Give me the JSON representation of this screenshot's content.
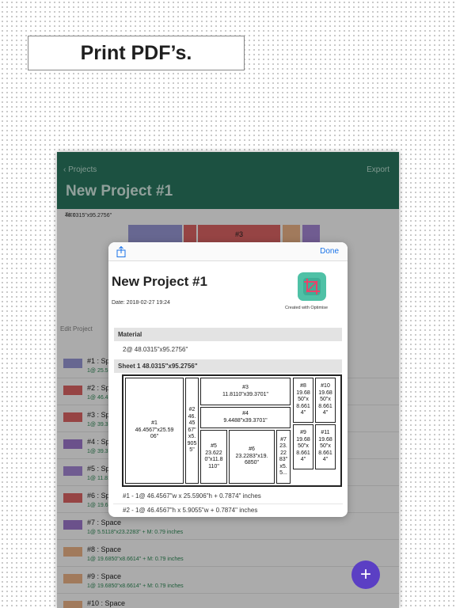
{
  "banner": {
    "text": "Print PDF’s."
  },
  "app": {
    "back_label": "Projects",
    "export_label": "Export",
    "title": "New Project #1",
    "size_caption": "Size",
    "size_value": "48.0315\"x95.2756\"",
    "preview_label": "#3",
    "edit_label": "Edit Project",
    "list": [
      {
        "name": "#1 : Space",
        "detail": "1@ 25.5906\"x46.4567\" + M: 0.79 inches",
        "color": "#9a9ad9"
      },
      {
        "name": "#2 : Space",
        "detail": "1@ 46.4567\"x5.9055\" + M: 0.79 inches",
        "color": "#e06666"
      },
      {
        "name": "#3 : Space",
        "detail": "1@ 39.3701\"x11.8110\" + M: 0.79 inches",
        "color": "#e06666"
      },
      {
        "name": "#4 : Space",
        "detail": "1@ 39.3701\"x9.4488\" + M: 0.79 inches",
        "color": "#a07ad0"
      },
      {
        "name": "#5 : Space",
        "detail": "1@ 11.8110\"x23.6220\" + M: 0.79 inches",
        "color": "#a88ad8"
      },
      {
        "name": "#6 : Space",
        "detail": "1@ 19.6850\"x23.2283\" + M: 0.79 inches",
        "color": "#e06666"
      },
      {
        "name": "#7 : Space",
        "detail": "1@ 5.5118\"x23.2283\" + M: 0.79 inches",
        "color": "#a07ad0"
      },
      {
        "name": "#8 : Space",
        "detail": "1@ 19.6850\"x8.6614\" + M: 0.79 inches",
        "color": "#f0b78a"
      },
      {
        "name": "#9 : Space",
        "detail": "1@ 19.6850\"x8.6614\" + M: 0.79 inches",
        "color": "#f0b78a"
      },
      {
        "name": "#10 : Space",
        "detail": "",
        "color": "#f0b78a"
      }
    ],
    "fab_label": "+"
  },
  "sheet": {
    "done_label": "Done",
    "title": "New Project #1",
    "date": "Date: 2018-02-27 19:24",
    "logo_caption": "Created with Optimise",
    "material_header": "Material",
    "material_line": "2@ 48.0315\"x95.2756\"",
    "sheet_header": "Sheet 1 48.0315\"x95.2756\"",
    "pieces": {
      "p1": "#1\n46.4567\"x25.59\n06\"",
      "p2": "#2\n46.\n45\n67\"\nx5.\n905\n5\"",
      "p3": "#3\n11.8110\"x39.3701\"",
      "p4": "#4\n9.4488\"x39.3701\"",
      "p5": "#5\n23.622\n0\"x11.8\n110\"",
      "p6": "#6\n23.2283\"x19.\n6850\"",
      "p7": "#7\n23.\n22\n83\"\nx5.\n5...",
      "p8": "#8\n19.68\n50\"x\n8.661\n4\"",
      "p9": "#9\n19.68\n50\"x\n8.661\n4\"",
      "p10": "#10\n19.68\n50\"x\n8.661\n4\"",
      "p11": "#11\n19.68\n50\"x\n8.661\n4\""
    },
    "cuts": [
      "#1 - 1@ 46.4567\"w x 25.5906\"h + 0.7874\" inches",
      "#2 - 1@ 46.4567\"h x 5.9055\"w + 0.7874\" inches"
    ]
  },
  "colors": {
    "nav": "#2a7a62",
    "fab": "#5b3fc4",
    "logo": "#4fc1a6",
    "link": "#1a73e8"
  }
}
